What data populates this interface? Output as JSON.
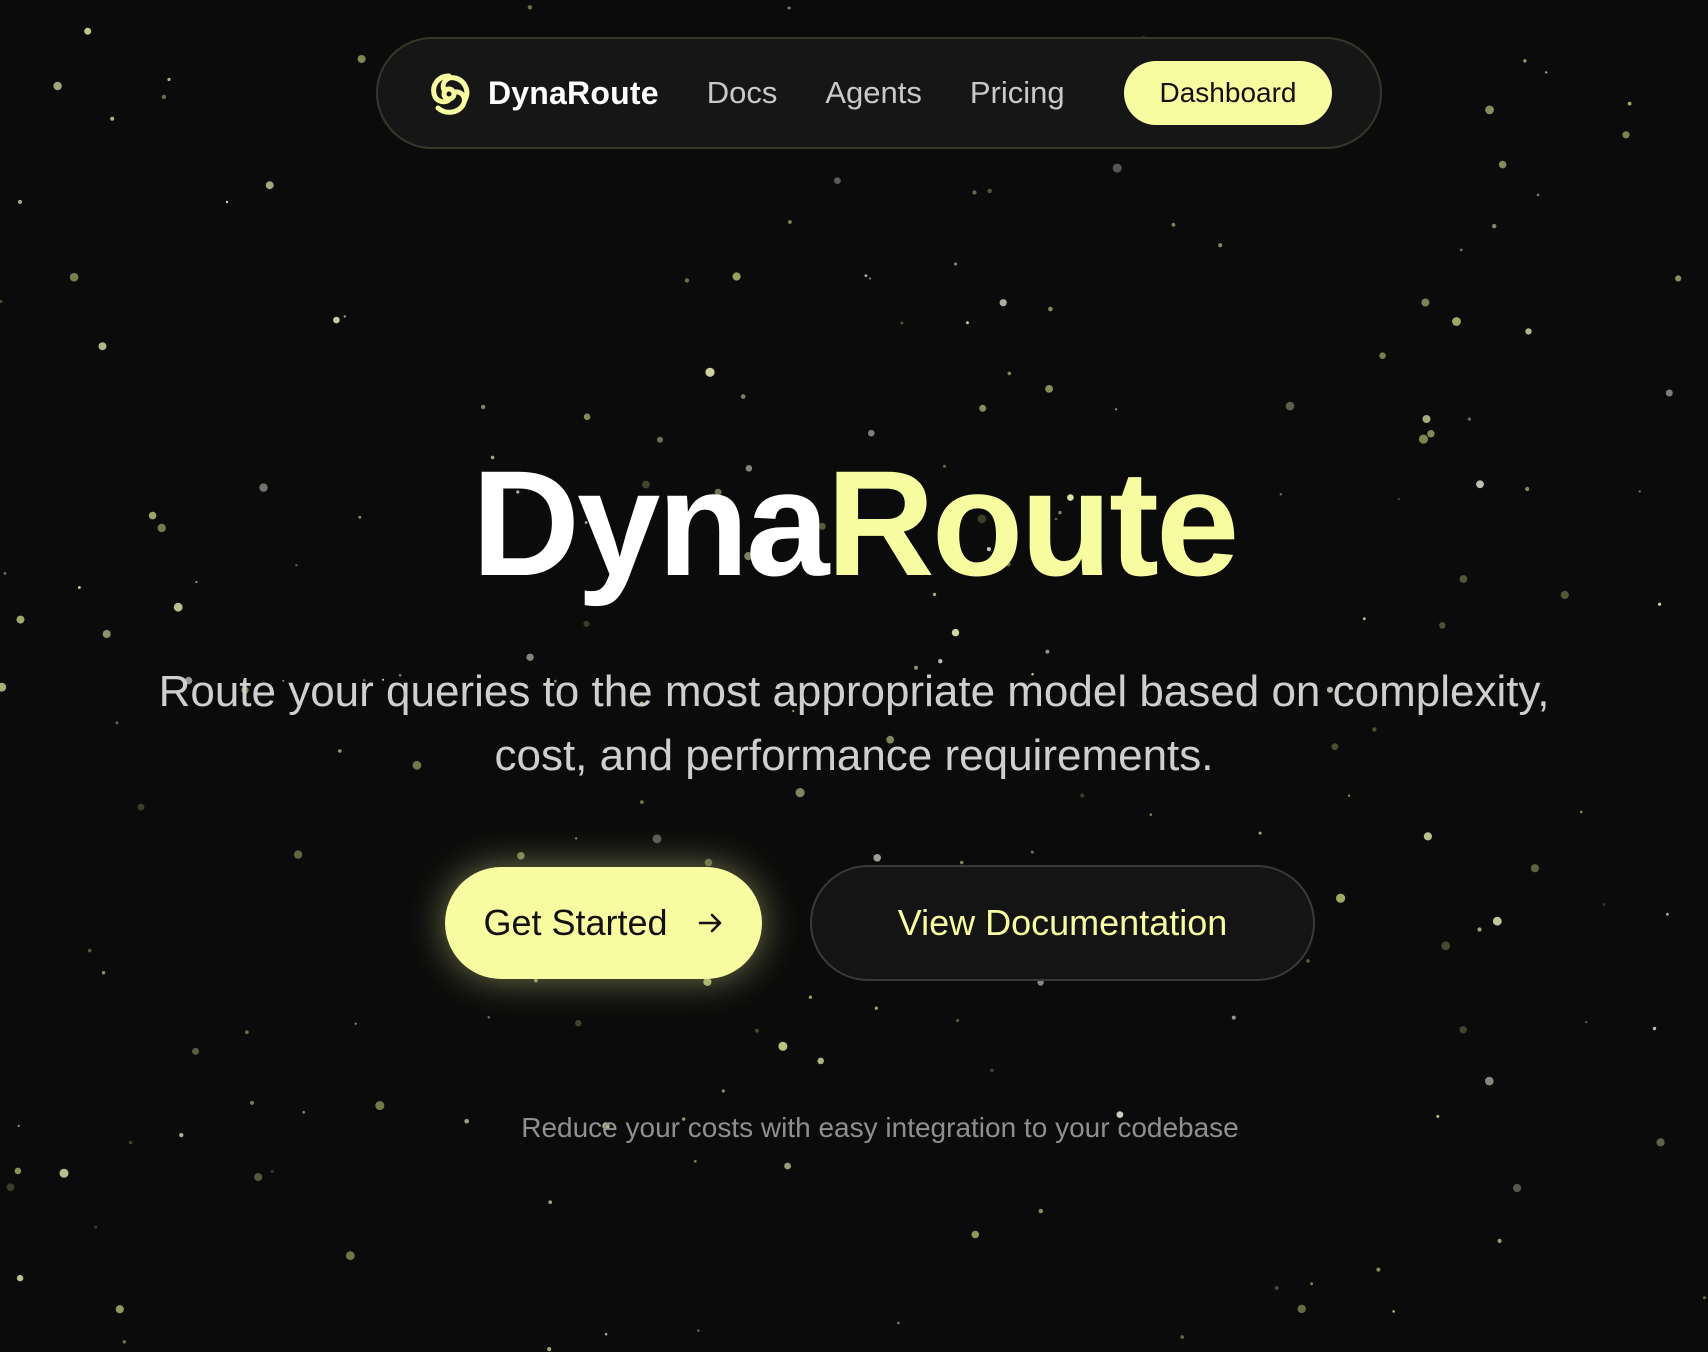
{
  "nav": {
    "brand": "DynaRoute",
    "links": [
      "Docs",
      "Agents",
      "Pricing"
    ],
    "dashboard_label": "Dashboard"
  },
  "hero": {
    "title_white": "Dyna",
    "title_yellow": "Route",
    "subtitle_line1": "Route your queries to the most appropriate model based on complexity,",
    "subtitle_line2": "cost, and performance requirements.",
    "primary_cta": "Get Started",
    "primary_cta_icon": "arrow-right-icon",
    "secondary_cta": "View Documentation",
    "tagline": "Reduce your costs with easy integration to your codebase"
  },
  "colors": {
    "background": "#0b0b0b",
    "accent": "#f7fca0",
    "nav_bg": "#161616"
  },
  "icons": {
    "logo": "dynaroute-logo-icon"
  }
}
